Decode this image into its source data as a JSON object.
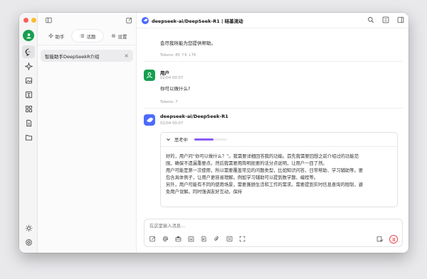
{
  "header": {
    "title": "deepseek-ai/DeepSeek-R1 | 硅基流动"
  },
  "tabs": [
    {
      "label": "助手",
      "icon": "sparkle-icon"
    },
    {
      "label": "话题",
      "icon": "list-icon"
    },
    {
      "label": "设置",
      "icon": "gear-icon"
    }
  ],
  "topics": [
    {
      "label": "智能助手DeepSeekR介绍"
    }
  ],
  "messages": {
    "prev_text": "会尽我所能为您提供帮助。",
    "prev_tokens": "Tokens: 85 ↑9 ↓76",
    "user_name": "用户",
    "user_time": "02/04 00:07",
    "user_text": "你可以做什么?",
    "user_tokens": "Tokens: 7",
    "assistant_name": "deepseek-ai/DeepSeek-R1",
    "assistant_time": "02/04 00:07",
    "thinking_label": "思考中",
    "thinking_progress": 0.6,
    "thinking_lines": [
      "好的，用户问“你可以做什么？”。我需要详细回答我的功能。首先我需要回想之前介绍过的功能范",
      "围，确保不遗漏重要点。然后我需要用简明扼要的话分点说明，让用户一目了然。",
      "用户可能是第一次使用，所以需要覆盖常见的问题类型，比如知识问答、日常帮助、学习辅助等。要",
      "包含具体例子，让用户更容易理解。例如学习辅助可以提到数学题、编程等。",
      "另外，用户可能有不同的使用场景，需要兼顾生活和工作的需求。需要提到实时信息查询的限制，避",
      "免用户误解。同时强调友好互动，保持"
    ]
  },
  "input": {
    "placeholder": "在这里输入消息..."
  },
  "colors": {
    "accent": "#15a04f",
    "deepseek": "#4d6bfe",
    "stop": "#e5484d",
    "thinking_bar": "#8b5cf6"
  }
}
